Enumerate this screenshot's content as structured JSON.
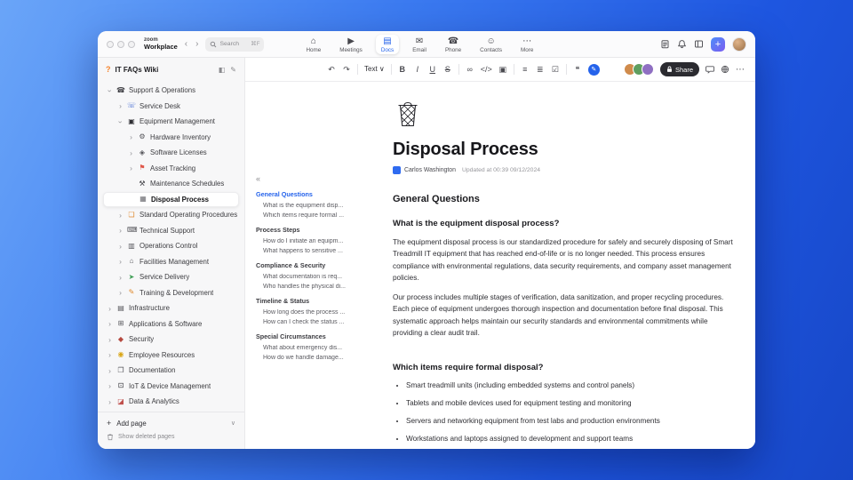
{
  "titlebar": {
    "logo_top": "zoom",
    "logo_bottom": "Workplace",
    "back_glyph": "‹",
    "forward_glyph": "›",
    "search_label": "Search",
    "search_shortcut": "⌘F",
    "new_glyph": "+",
    "tabs": [
      {
        "name": "tab-home",
        "label": "Home",
        "icon": "home-icon",
        "glyph": "⌂"
      },
      {
        "name": "tab-meetings",
        "label": "Meetings",
        "icon": "meetings-icon",
        "glyph": "▶"
      },
      {
        "name": "tab-docs",
        "label": "Docs",
        "icon": "docs-icon",
        "glyph": "▤",
        "active": true
      },
      {
        "name": "tab-email",
        "label": "Email",
        "icon": "email-icon",
        "glyph": "✉"
      },
      {
        "name": "tab-phone",
        "label": "Phone",
        "icon": "phone-icon",
        "glyph": "☎"
      },
      {
        "name": "tab-contacts",
        "label": "Contacts",
        "icon": "contacts-icon",
        "glyph": "☺"
      },
      {
        "name": "tab-more",
        "label": "More",
        "icon": "more-icon",
        "glyph": "⋯"
      }
    ]
  },
  "sidebar": {
    "badge_glyph": "?",
    "title": "IT FAQs Wiki",
    "collapse_glyph": "◧",
    "compose_glyph": "✎",
    "add_glyph": "+",
    "add_page_label": "Add page",
    "add_chevron_glyph": "∨",
    "show_deleted_label": "Show deleted pages",
    "items": [
      {
        "name": "sidebar-item-support-operations",
        "label": "Support & Operations",
        "level": 0,
        "chevron": "down",
        "icon": "phone-icon",
        "glyph": "☎",
        "color": "#3f3f44"
      },
      {
        "name": "sidebar-item-service-desk",
        "label": "Service Desk",
        "level": 1,
        "chevron": "right",
        "icon": "headset-icon",
        "glyph": "☏",
        "color": "#4a6fd4"
      },
      {
        "name": "sidebar-item-equipment-management",
        "label": "Equipment Management",
        "level": 1,
        "chevron": "down",
        "icon": "equipment-icon",
        "glyph": "▣",
        "color": "#2f2f34"
      },
      {
        "name": "sidebar-item-hardware-inventory",
        "label": "Hardware Inventory",
        "level": 2,
        "chevron": "right",
        "icon": "gear-icon",
        "glyph": "⚙",
        "color": "#55555a"
      },
      {
        "name": "sidebar-item-software-licenses",
        "label": "Software Licenses",
        "level": 2,
        "chevron": "right",
        "icon": "software-icon",
        "glyph": "◈",
        "color": "#55555a"
      },
      {
        "name": "sidebar-item-asset-tracking",
        "label": "Asset Tracking",
        "level": 2,
        "chevron": "right",
        "icon": "location-pin-icon",
        "glyph": "⚑",
        "color": "#e0584b"
      },
      {
        "name": "sidebar-item-maintenance-schedules",
        "label": "Maintenance Schedules",
        "level": 2,
        "chevron": "none",
        "icon": "tools-icon",
        "glyph": "⚒",
        "color": "#3f3f44"
      },
      {
        "name": "sidebar-item-disposal-process",
        "label": "Disposal Process",
        "level": 2,
        "chevron": "none",
        "icon": "trash-icon",
        "glyph": "▦",
        "color": "#6a6a70",
        "selected": true
      },
      {
        "name": "sidebar-item-standard-operating-procedures",
        "label": "Standard Operating Procedures",
        "level": 1,
        "chevron": "right",
        "icon": "book-icon",
        "glyph": "❏",
        "color": "#e08a2e"
      },
      {
        "name": "sidebar-item-technical-support",
        "label": "Technical Support",
        "level": 1,
        "chevron": "right",
        "icon": "keyboard-icon",
        "glyph": "⌨",
        "color": "#55555a"
      },
      {
        "name": "sidebar-item-operations-control",
        "label": "Operations Control",
        "level": 1,
        "chevron": "right",
        "icon": "control-panel-icon",
        "glyph": "▥",
        "color": "#55555a"
      },
      {
        "name": "sidebar-item-facilities-management",
        "label": "Facilities Management",
        "level": 1,
        "chevron": "right",
        "icon": "building-icon",
        "glyph": "⌂",
        "color": "#55555a"
      },
      {
        "name": "sidebar-item-service-delivery",
        "label": "Service Delivery",
        "level": 1,
        "chevron": "right",
        "icon": "delivery-icon",
        "glyph": "➤",
        "color": "#3f9e55"
      },
      {
        "name": "sidebar-item-training-development",
        "label": "Training & Development",
        "level": 1,
        "chevron": "right",
        "icon": "pencil-icon",
        "glyph": "✎",
        "color": "#e08a2e"
      },
      {
        "name": "sidebar-item-infrastructure",
        "label": "Infrastructure",
        "level": 0,
        "chevron": "right",
        "icon": "server-icon",
        "glyph": "▤",
        "color": "#55555a"
      },
      {
        "name": "sidebar-item-applications-software",
        "label": "Applications & Software",
        "level": 0,
        "chevron": "right",
        "icon": "apps-grid-icon",
        "glyph": "⊞",
        "color": "#55555a"
      },
      {
        "name": "sidebar-item-security",
        "label": "Security",
        "level": 0,
        "chevron": "right",
        "icon": "shield-icon",
        "glyph": "◆",
        "color": "#b5493f"
      },
      {
        "name": "sidebar-item-employee-resources",
        "label": "Employee Resources",
        "level": 0,
        "chevron": "right",
        "icon": "people-icon",
        "glyph": "◉",
        "color": "#d9a514"
      },
      {
        "name": "sidebar-item-documentation",
        "label": "Documentation",
        "level": 0,
        "chevron": "right",
        "icon": "documents-icon",
        "glyph": "❐",
        "color": "#55555a"
      },
      {
        "name": "sidebar-item-iot-device-management",
        "label": "IoT & Device Management",
        "level": 0,
        "chevron": "right",
        "icon": "device-chip-icon",
        "glyph": "⊡",
        "color": "#2f2f34"
      },
      {
        "name": "sidebar-item-data-analytics",
        "label": "Data & Analytics",
        "level": 0,
        "chevron": "right",
        "icon": "chart-icon",
        "glyph": "◪",
        "color": "#c0504d"
      }
    ]
  },
  "doc_toolbar": {
    "share_label": "Share",
    "ai_glyph": "✎",
    "more_glyph": "⋯",
    "buttons": [
      {
        "name": "undo-button",
        "icon": "undo-icon",
        "glyph": "↶"
      },
      {
        "name": "redo-button",
        "icon": "redo-icon",
        "glyph": "↷"
      },
      {
        "divider": true
      },
      {
        "name": "text-style-dropdown",
        "icon": "chevron-down-icon",
        "glyph": "Text ∨",
        "cls": "drop"
      },
      {
        "divider": true
      },
      {
        "name": "bold-button",
        "icon": "bold-icon",
        "glyph": "B",
        "cls": "fb"
      },
      {
        "name": "italic-button",
        "icon": "italic-icon",
        "glyph": "I",
        "cls": "fi"
      },
      {
        "name": "underline-button",
        "icon": "underline-icon",
        "glyph": "U",
        "cls": "fu"
      },
      {
        "name": "strikethrough-button",
        "icon": "strikethrough-icon",
        "glyph": "S",
        "cls": "fs"
      },
      {
        "divider": true
      },
      {
        "name": "link-button",
        "icon": "link-icon",
        "glyph": "∞"
      },
      {
        "name": "code-button",
        "icon": "code-icon",
        "glyph": "</>"
      },
      {
        "name": "image-button",
        "icon": "image-icon",
        "glyph": "▣"
      },
      {
        "divider": true
      },
      {
        "name": "bullet-list-button",
        "icon": "bullet-list-icon",
        "glyph": "≡"
      },
      {
        "name": "align-button",
        "icon": "align-icon",
        "glyph": "≣"
      },
      {
        "name": "checklist-button",
        "icon": "checklist-icon",
        "glyph": "☑"
      },
      {
        "divider": true
      },
      {
        "name": "comment-button",
        "icon": "comment-icon",
        "glyph": "❝"
      }
    ],
    "collaborators": [
      {
        "name": "collaborator-avatar",
        "bg": "#d08b4c"
      },
      {
        "name": "collaborator-avatar",
        "bg": "#5f9e5f"
      },
      {
        "name": "collaborator-avatar",
        "bg": "#8f6fc2"
      }
    ]
  },
  "outline": {
    "collapse_glyph": "«",
    "entries": [
      {
        "type": "section",
        "label": "General Questions",
        "active": true
      },
      {
        "type": "item",
        "label": "What is the equipment disp..."
      },
      {
        "type": "item",
        "label": "Which items require formal ..."
      },
      {
        "type": "section",
        "label": "Process Steps"
      },
      {
        "type": "item",
        "label": "How do I initiate an equipm..."
      },
      {
        "type": "item",
        "label": "What happens to sensitive ..."
      },
      {
        "type": "section",
        "label": "Compliance & Security"
      },
      {
        "type": "item",
        "label": "What documentation is req..."
      },
      {
        "type": "item",
        "label": "Who handles the physical di..."
      },
      {
        "type": "section",
        "label": "Timeline & Status"
      },
      {
        "type": "item",
        "label": "How long does the process ..."
      },
      {
        "type": "item",
        "label": "How can I check the status ..."
      },
      {
        "type": "section",
        "label": "Special Circumstances"
      },
      {
        "type": "item",
        "label": "What about emergency dis..."
      },
      {
        "type": "item",
        "label": "How do we handle damage..."
      }
    ]
  },
  "doc": {
    "title": "Disposal Process",
    "author": "Carlos Washington",
    "updated": "Updated at 00:39 09/12/2024",
    "heading": "General Questions",
    "question1": "What is the equipment disposal process?",
    "paragraph1": "The equipment disposal process is our standardized procedure for safely and securely disposing of Smart Treadmill IT equipment that has reached end-of-life or is no longer needed. This process ensures compliance with environmental regulations, data security requirements, and company asset management policies.",
    "paragraph2": "Our process includes multiple stages of verification, data sanitization, and proper recycling procedures. Each piece of equipment undergoes thorough inspection and documentation before final disposal. This systematic approach helps maintain our security standards and environmental commitments while providing a clear audit trail.",
    "question2": "Which items require formal disposal?",
    "bullets": [
      {
        "text": "Smart treadmill units (including embedded systems and control panels)"
      },
      {
        "text": "Tablets and mobile devices used for equipment testing and monitoring"
      },
      {
        "text": "Servers and networking equipment from test labs and production environments"
      },
      {
        "text": "Workstations and laptops assigned to development and support teams"
      }
    ]
  }
}
